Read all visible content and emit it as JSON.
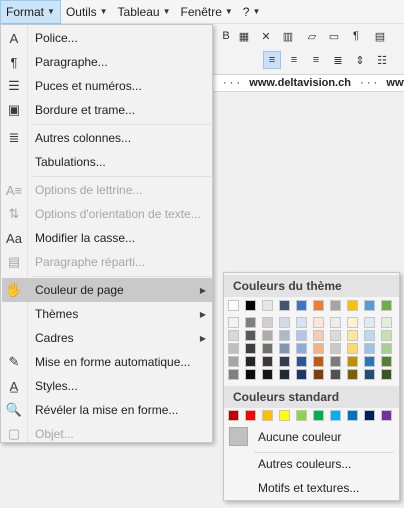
{
  "menubar": [
    {
      "label": "Format",
      "active": true
    },
    {
      "label": "Outils",
      "active": false
    },
    {
      "label": "Tableau",
      "active": false
    },
    {
      "label": "Fenêtre",
      "active": false
    },
    {
      "label": "?",
      "active": false
    }
  ],
  "ruler_text": {
    "w": "www.deltavision.ch",
    "sep": "·  ·  ·",
    "tail": "www.delta"
  },
  "menu_items": [
    {
      "label": "Police...",
      "icon": "font-a-icon",
      "glyph": "A",
      "disabled": false,
      "submenu": false
    },
    {
      "label": "Paragraphe...",
      "icon": "paragraph-icon",
      "glyph": "¶",
      "disabled": false,
      "submenu": false
    },
    {
      "label": "Puces et numéros...",
      "icon": "bullets-icon",
      "glyph": "☰",
      "disabled": false,
      "submenu": false
    },
    {
      "label": "Bordure et trame...",
      "icon": "border-icon",
      "glyph": "▣",
      "disabled": false,
      "submenu": false
    },
    {
      "label": "Autres colonnes...",
      "icon": "columns-icon",
      "glyph": "≣",
      "disabled": false,
      "submenu": false
    },
    {
      "label": "Tabulations...",
      "icon": "",
      "glyph": "",
      "disabled": false,
      "submenu": false
    },
    {
      "label": "Options de lettrine...",
      "icon": "drop-cap-icon",
      "glyph": "A≡",
      "disabled": true,
      "submenu": false
    },
    {
      "label": "Options d'orientation de texte...",
      "icon": "text-direction-icon",
      "glyph": "⇅",
      "disabled": true,
      "submenu": false
    },
    {
      "label": "Modifier la casse...",
      "icon": "change-case-icon",
      "glyph": "Aa",
      "disabled": false,
      "submenu": false
    },
    {
      "label": "Paragraphe réparti...",
      "icon": "distributed-icon",
      "glyph": "▤",
      "disabled": true,
      "submenu": false
    },
    {
      "label": "Couleur de page",
      "icon": "page-color-icon",
      "glyph": "🖐",
      "disabled": false,
      "submenu": true,
      "highlight": true
    },
    {
      "label": "Thèmes",
      "icon": "",
      "glyph": "",
      "disabled": false,
      "submenu": true
    },
    {
      "label": "Cadres",
      "icon": "",
      "glyph": "",
      "disabled": false,
      "submenu": true
    },
    {
      "label": "Mise en forme automatique...",
      "icon": "autoformat-icon",
      "glyph": "✎",
      "disabled": false,
      "submenu": false
    },
    {
      "label": "Styles...",
      "icon": "styles-icon",
      "glyph": "A̲",
      "disabled": false,
      "submenu": false
    },
    {
      "label": "Révéler la mise en forme...",
      "icon": "reveal-formatting-icon",
      "glyph": "🔍",
      "disabled": false,
      "submenu": false
    },
    {
      "label": "Objet...",
      "icon": "object-icon",
      "glyph": "▢",
      "disabled": true,
      "submenu": false
    }
  ],
  "submenu": {
    "theme_header": "Couleurs du thème",
    "standard_header": "Couleurs standard",
    "theme_top": [
      "#ffffff",
      "#000000",
      "#e7e6e6",
      "#44546a",
      "#4472c4",
      "#ed7d31",
      "#a5a5a5",
      "#ffc000",
      "#5b9bd5",
      "#70ad47"
    ],
    "theme_shades": [
      [
        "#f2f2f2",
        "#7f7f7f",
        "#d0cece",
        "#d6dce4",
        "#d9e2f3",
        "#fbe5d5",
        "#ededed",
        "#fff2cc",
        "#deeaf6",
        "#e2efd9"
      ],
      [
        "#d8d8d8",
        "#595959",
        "#aeabab",
        "#adb9ca",
        "#b4c6e7",
        "#f7cbac",
        "#dbdbdb",
        "#fee599",
        "#bdd7ee",
        "#c5e0b3"
      ],
      [
        "#bfbfbf",
        "#3f3f3f",
        "#757070",
        "#8496b0",
        "#8eaadb",
        "#f4b183",
        "#c9c9c9",
        "#ffd965",
        "#9cc3e5",
        "#a8d08d"
      ],
      [
        "#a5a5a5",
        "#262626",
        "#3a3838",
        "#323f4f",
        "#2f5496",
        "#c55a11",
        "#7b7b7b",
        "#bf9000",
        "#2e75b5",
        "#538135"
      ],
      [
        "#7f7f7f",
        "#0c0c0c",
        "#171616",
        "#222a35",
        "#1f3763",
        "#833c0b",
        "#525252",
        "#7f6000",
        "#1e4e79",
        "#375623"
      ]
    ],
    "standard": [
      "#c00000",
      "#ff0000",
      "#ffc000",
      "#ffff00",
      "#92d050",
      "#00b050",
      "#00b0f0",
      "#0070c0",
      "#002060",
      "#7030a0"
    ],
    "no_color_label": "Aucune couleur",
    "more_colors_label": "Autres couleurs...",
    "patterns_label": "Motifs et textures..."
  }
}
